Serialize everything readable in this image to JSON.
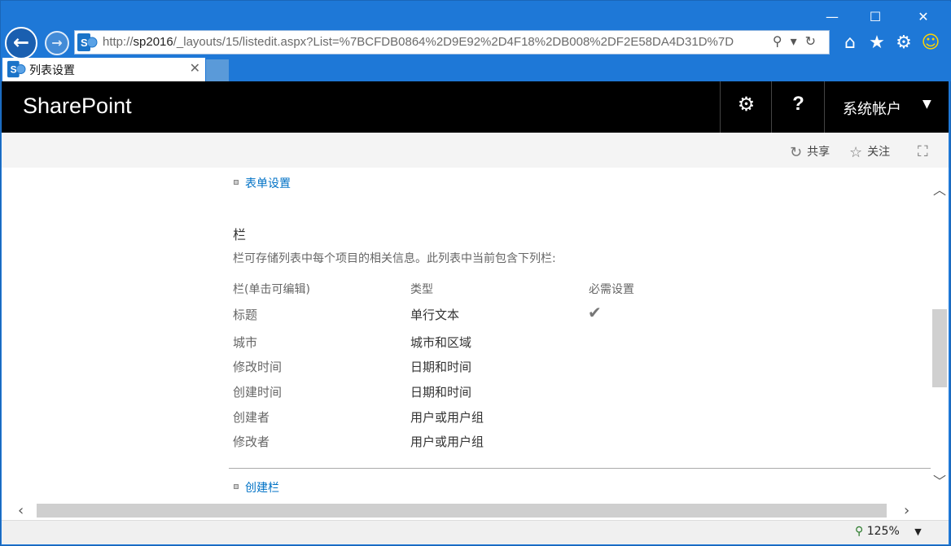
{
  "browser": {
    "window_controls": {
      "minimize": "—",
      "maximize": "☐",
      "close": "✕"
    },
    "address": {
      "url_prefix": "http://",
      "url_host": "sp2016",
      "url_rest": "/_layouts/15/listedit.aspx?List=%7BCFDB0864%2D9E92%2D4F18%2DB008%2DF2E58DA4D31D%7D"
    },
    "tab": {
      "title": "列表设置"
    },
    "zoom": "125%"
  },
  "suite_bar": {
    "brand": "SharePoint",
    "help_label": "?",
    "user_name": "系统帐户"
  },
  "ribbon": {
    "share_label": "共享",
    "follow_label": "关注"
  },
  "content": {
    "form_settings_link": "表单设置",
    "columns_heading": "栏",
    "columns_description": "栏可存储列表中每个项目的相关信息。此列表中当前包含下列栏:",
    "table": {
      "headers": [
        "栏(单击可编辑)",
        "类型",
        "必需设置"
      ],
      "rows": [
        {
          "name": "标题",
          "type": "单行文本",
          "required": true
        },
        {
          "name": "城市",
          "type": "城市和区域",
          "required": false
        },
        {
          "name": "修改时间",
          "type": "日期和时间",
          "required": false
        },
        {
          "name": "创建时间",
          "type": "日期和时间",
          "required": false
        },
        {
          "name": "创建者",
          "type": "用户或用户组",
          "required": false
        },
        {
          "name": "修改者",
          "type": "用户或用户组",
          "required": false
        }
      ]
    },
    "create_column_link": "创建栏"
  }
}
